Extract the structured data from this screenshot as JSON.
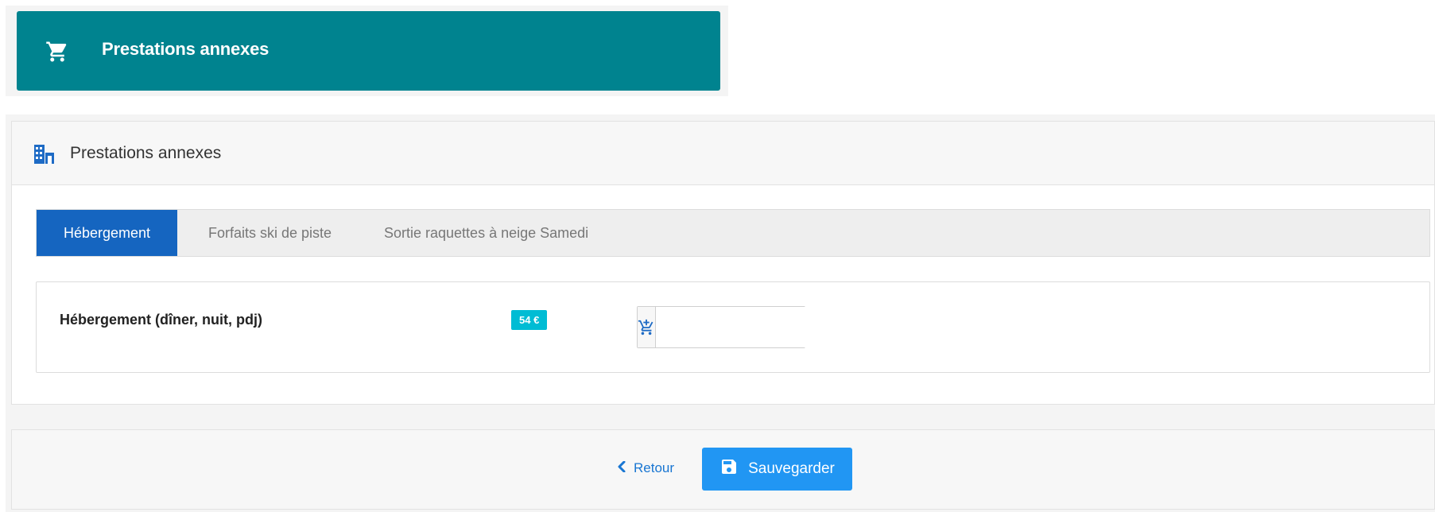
{
  "top_banner": {
    "icon": "shopping-cart-icon",
    "title": "Prestations annexes",
    "bg_color": "#00838f"
  },
  "panel": {
    "icon": "building-icon",
    "title": "Prestations annexes",
    "tabs": [
      {
        "label": "Hébergement",
        "active": true
      },
      {
        "label": "Forfaits ski de piste",
        "active": false
      },
      {
        "label": "Sortie raquettes à neige Samedi",
        "active": false
      }
    ],
    "active_tab_color": "#1565c0",
    "item": {
      "label": "Hébergement (dîner, nuit, pdj)",
      "price": "54 €",
      "price_badge_color": "#00bcd4",
      "quantity_icon": "cart-plus-icon",
      "quantity_value": ""
    }
  },
  "footer": {
    "back_label": "Retour",
    "back_icon": "chevron-left-icon",
    "save_label": "Sauvegarder",
    "save_icon": "floppy-disk-icon",
    "save_color": "#2196f3"
  }
}
